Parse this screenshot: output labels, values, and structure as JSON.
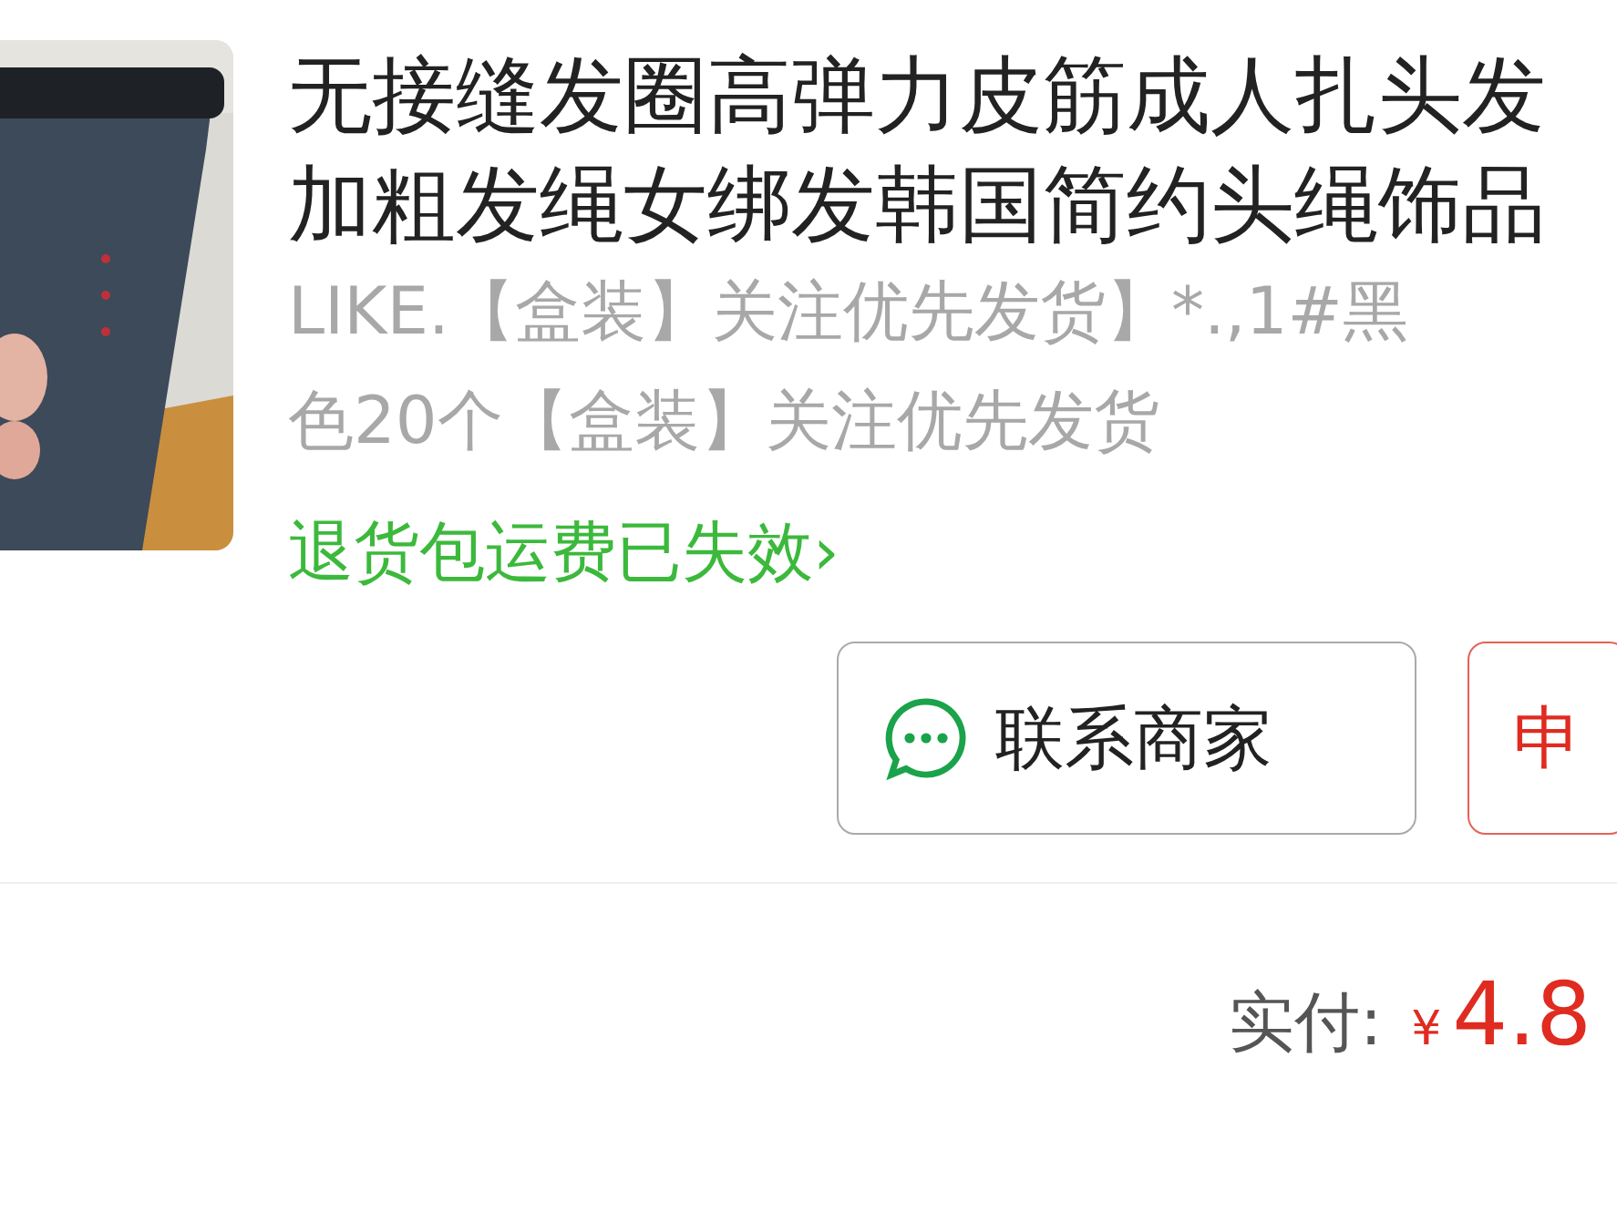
{
  "product": {
    "title_lines": [
      "无接缝发圈高弹力皮筋成人扎头发",
      "加粗发绳女绑发韩国简约头绳饰品"
    ],
    "spec_lines": [
      "LIKE.【盒装】关注优先发货】*.,1#黑",
      "色20个【盒装】关注优先发货"
    ],
    "return_link": {
      "label": "退货包运费已失效",
      "arrow": "›"
    }
  },
  "actions": [
    {
      "kind": "outline",
      "label": "联系商家"
    },
    {
      "kind": "danger",
      "label": "申"
    }
  ],
  "payment": {
    "label": "实付:",
    "currency": "¥",
    "amount": "4.8"
  }
}
